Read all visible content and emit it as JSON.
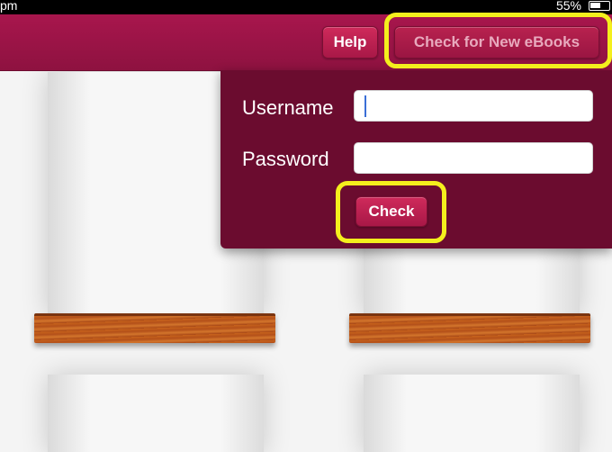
{
  "status_bar": {
    "time": "pm",
    "battery": "55%",
    "battery_icon": "battery-icon"
  },
  "header": {
    "help_label": "Help",
    "check_new_label": "Check for New eBooks"
  },
  "login": {
    "username_label": "Username",
    "password_label": "Password",
    "username_value": "",
    "password_value": "",
    "check_label": "Check"
  },
  "colors": {
    "header": "#9b1445",
    "popover": "#6b0c2f",
    "button": "#c02355",
    "highlight": "#f4ef1d",
    "shelf_wood": "#c8631c"
  }
}
